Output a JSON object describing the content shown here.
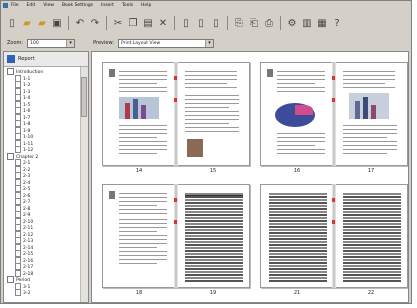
{
  "menu": [
    "File",
    "Edit",
    "View",
    "Book Settings",
    "Insert",
    "Tools",
    "Help"
  ],
  "toolbar_icons": [
    "new-icon",
    "open-icon",
    "open-folder-icon",
    "save-icon",
    "undo-icon",
    "redo-icon",
    "cut-icon",
    "copy-icon",
    "paste-icon",
    "delete-icon",
    "page-icon",
    "page-icon-2",
    "page-icon-3",
    "add-page-icon",
    "remove-page-icon",
    "move-page-icon",
    "settings-icon",
    "book-icon",
    "help-icon"
  ],
  "options": {
    "zoom_label": "Zoom:",
    "zoom_value": "100",
    "preview_label": "Preview:",
    "preview_value": "Print Layout View"
  },
  "left_pane": {
    "title": "Report",
    "tree": [
      {
        "label": "Introduction",
        "level": 0
      },
      {
        "label": "1-1",
        "level": 1
      },
      {
        "label": "1-2",
        "level": 1
      },
      {
        "label": "1-3",
        "level": 1
      },
      {
        "label": "1-4",
        "level": 1
      },
      {
        "label": "1-5",
        "level": 1
      },
      {
        "label": "1-6",
        "level": 1
      },
      {
        "label": "1-7",
        "level": 1
      },
      {
        "label": "1-8",
        "level": 1
      },
      {
        "label": "1-9",
        "level": 1
      },
      {
        "label": "1-10",
        "level": 1
      },
      {
        "label": "1-11",
        "level": 1
      },
      {
        "label": "1-12",
        "level": 1
      },
      {
        "label": "Chapter 2",
        "level": 0
      },
      {
        "label": "2-1",
        "level": 1
      },
      {
        "label": "2-2",
        "level": 1
      },
      {
        "label": "2-3",
        "level": 1
      },
      {
        "label": "2-4",
        "level": 1
      },
      {
        "label": "2-5",
        "level": 1
      },
      {
        "label": "2-6",
        "level": 1
      },
      {
        "label": "2-7",
        "level": 1
      },
      {
        "label": "2-8",
        "level": 1
      },
      {
        "label": "2-9",
        "level": 1
      },
      {
        "label": "2-10",
        "level": 1
      },
      {
        "label": "2-11",
        "level": 1
      },
      {
        "label": "2-12",
        "level": 1
      },
      {
        "label": "2-13",
        "level": 1
      },
      {
        "label": "2-14",
        "level": 1
      },
      {
        "label": "2-15",
        "level": 1
      },
      {
        "label": "2-16",
        "level": 1
      },
      {
        "label": "2-17",
        "level": 1
      },
      {
        "label": "2-18",
        "level": 1
      },
      {
        "label": "Period",
        "level": 0
      },
      {
        "label": "3-1",
        "level": 1
      },
      {
        "label": "3-2",
        "level": 1
      }
    ]
  },
  "spreads": [
    {
      "left": "14",
      "right": "15"
    },
    {
      "left": "16",
      "right": "17"
    },
    {
      "left": "18",
      "right": "19"
    },
    {
      "left": "21",
      "right": "22"
    }
  ]
}
